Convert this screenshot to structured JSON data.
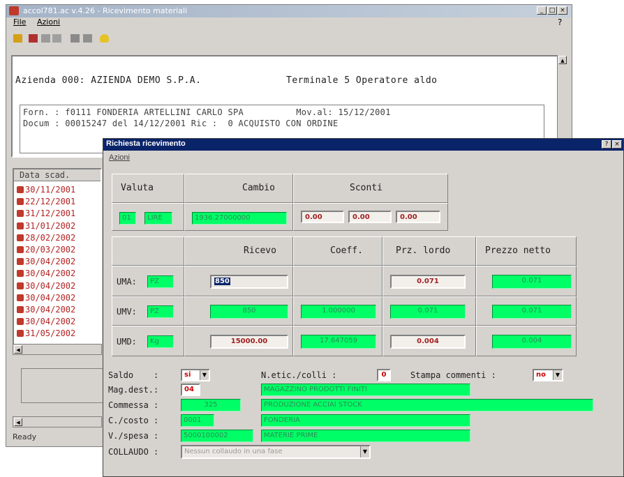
{
  "main_window": {
    "title": "accol781.ac v.4.26 - Ricevimento materiali",
    "menu": {
      "file": "File",
      "azioni": "Azioni"
    },
    "help": "?",
    "company_line": "Azienda 000: AZIENDA DEMO S.P.A.",
    "terminal_line": "Terminale  5 Operatore aldo",
    "supplier_line": "Forn. : f0111 FONDERIA ARTELLINI CARLO SPA          Mov.al: 15/12/2001",
    "document_line": "Docum : 00015247 del 14/12/2001 Ric :  0 ACQUISTO CON ORDINE",
    "dates_header": "Data scad.",
    "dates": [
      "30/11/2001",
      "22/12/2001",
      "31/12/2001",
      "31/01/2002",
      "28/02/2002",
      "20/03/2002",
      "30/04/2002",
      "30/04/2002",
      "30/04/2002",
      "30/04/2002",
      "30/04/2002",
      "30/04/2002",
      "31/05/2002"
    ],
    "status": "Ready"
  },
  "dialog": {
    "title": "Richiesta ricevimento",
    "menu_azioni": "Azioni",
    "valuta_header": "Valuta",
    "cambio_header": "Cambio",
    "sconti_header": "Sconti",
    "valuta_code": "01",
    "valuta_name": "LIRE",
    "cambio_value": "1936.27000000",
    "sconti": [
      "0.00",
      "0.00",
      "0.00"
    ],
    "col_headers": {
      "ricevo": "Ricevo",
      "coeff": "Coeff.",
      "prz_lordo": "Prz. lordo",
      "prezzo_netto": "Prezzo netto"
    },
    "rows": [
      {
        "label": "UMA:",
        "um": "PZ",
        "ricevo": "850",
        "coeff": "",
        "prz_lordo": "0.071",
        "prezzo_netto": "0.071"
      },
      {
        "label": "UMV:",
        "um": "PZ",
        "ricevo": "850",
        "coeff": "1.000000",
        "prz_lordo": "0.071",
        "prezzo_netto": "0.071"
      },
      {
        "label": "UMD:",
        "um": "Kg",
        "ricevo": "15000.00",
        "coeff": "17.647059",
        "prz_lordo": "0.004",
        "prezzo_netto": "0.004"
      }
    ],
    "saldo_label": "Saldo    :",
    "saldo_value": "si",
    "netic_label": "N.etic./colli :",
    "netic_value": "0",
    "stampa_label": "Stampa commenti :",
    "stampa_value": "no",
    "mag_label": "Mag.dest.:",
    "mag_code": "04",
    "mag_desc": "MAGAZZINO PRODOTTI FINITI",
    "commessa_label": "Commessa :",
    "commessa_code": "325",
    "commessa_desc": "PRODUZIONE ACCIAI STOCK",
    "ccosto_label": "C./costo :",
    "ccosto_code": "0001",
    "ccosto_desc": "FONDERIA",
    "vspesa_label": "V./spesa :",
    "vspesa_code": "5000100002",
    "vspesa_desc": "MATERIE PRIME",
    "collaudo_label": "COLLAUDO :",
    "collaudo_value": "Nessun collaudo in una fase"
  }
}
